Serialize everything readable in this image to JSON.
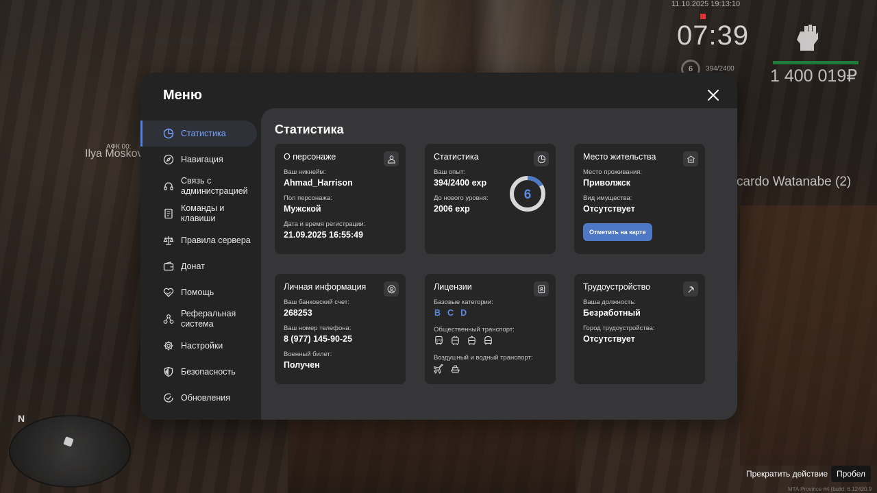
{
  "hud": {
    "datetime": "11.10.2025 19:13:10",
    "time": "07:39",
    "level": "6",
    "exp": "394/2400",
    "money": "1 400 019₽",
    "nametag_left": "Ilya Moskov",
    "nametag_afk": "АФК 00:",
    "nametag_right": "cardo Watanabe (2)",
    "minimap_north": "N",
    "hint_action": "Прекратить действие",
    "hint_key": "Пробел",
    "build": "MTA Province #4 (build: 6.12420.9"
  },
  "menu": {
    "title": "Меню",
    "sidebar": [
      {
        "label": "Статистика",
        "icon": "pie-chart-icon",
        "active": true
      },
      {
        "label": "Навигация",
        "icon": "compass-icon",
        "active": false
      },
      {
        "label": "Связь с\nадминистрацией",
        "icon": "headset-icon",
        "active": false
      },
      {
        "label": "Команды и\nклавиши",
        "icon": "document-icon",
        "active": false
      },
      {
        "label": "Правила сервера",
        "icon": "scales-icon",
        "active": false
      },
      {
        "label": "Донат",
        "icon": "wallet-icon",
        "active": false
      },
      {
        "label": "Помощь",
        "icon": "handshake-heart-icon",
        "active": false
      },
      {
        "label": "Реферальная\nсистема",
        "icon": "network-icon",
        "active": false
      },
      {
        "label": "Настройки",
        "icon": "gear-icon",
        "active": false
      },
      {
        "label": "Безопасность",
        "icon": "shield-icon",
        "active": false
      },
      {
        "label": "Обновления",
        "icon": "check-circle-icon",
        "active": false
      }
    ]
  },
  "content": {
    "title": "Статистика",
    "character": {
      "title": "О персонаже",
      "nick_label": "Ваш никнейм:",
      "nick": "Ahmad_Harrison",
      "gender_label": "Пол персонажа:",
      "gender": "Мужской",
      "reg_label": "Дата и время регистрации:",
      "reg": "21.09.2025 16:55:49"
    },
    "stats": {
      "title": "Статистика",
      "exp_label": "Ваш опыт:",
      "exp": "394/2400 exp",
      "next_label": "До нового уровня:",
      "next": "2006 exp",
      "level": "6",
      "progress": 0.164
    },
    "residence": {
      "title": "Место жительства",
      "place_label": "Место проживания:",
      "place": "Приволжск",
      "property_label": "Вид имущества:",
      "property": "Отсутствует",
      "map_button": "Отметить на карте"
    },
    "personal": {
      "title": "Личная информация",
      "bank_label": "Ваш банковский счет:",
      "bank": "268253",
      "phone_label": "Ваш номер телефона:",
      "phone": "8 (977) 145-90-25",
      "military_label": "Военный билет:",
      "military": "Получен"
    },
    "licenses": {
      "title": "Лицензии",
      "base_label": "Базовые категории:",
      "categories": [
        "B",
        "C",
        "D"
      ],
      "public_label": "Общественный транспорт:",
      "air_label": "Воздушный и водный транспорт:"
    },
    "employment": {
      "title": "Трудоустройство",
      "position_label": "Ваша должность:",
      "position": "Безработный",
      "city_label": "Город трудоустройства:",
      "city": "Отсутствует"
    }
  },
  "colors": {
    "accent": "#4f7fe8",
    "ring_track": "#d8d8d8",
    "ring_fill": "#4e77c4"
  }
}
